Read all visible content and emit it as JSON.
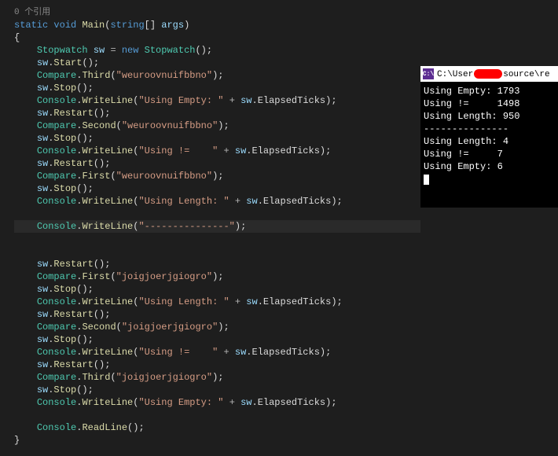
{
  "editor": {
    "ref_count": "0 个引用",
    "sig_static": "static",
    "sig_void": "void",
    "sig_main": "Main",
    "sig_string": "string",
    "sig_args": "args",
    "brace_open": "{",
    "brace_close": "}",
    "type_stopwatch": "Stopwatch",
    "var_sw": "sw",
    "kw_new": "new",
    "m_start": "Start",
    "m_stop": "Stop",
    "m_restart": "Restart",
    "m_writeline": "WriteLine",
    "m_readline": "ReadLine",
    "m_first": "First",
    "m_second": "Second",
    "m_third": "Third",
    "type_compare": "Compare",
    "type_console": "Console",
    "prop_elapsed": "ElapsedTicks",
    "str_test1": "\"weuroovnuifbbno\"",
    "str_test2": "\"joigjoerjgiogro\"",
    "str_empty": "\"Using Empty: \"",
    "str_ne": "\"Using !=    \"",
    "str_len": "\"Using Length: \"",
    "str_dash": "\"---------------\""
  },
  "console": {
    "title_prefix": "C:\\User",
    "title_suffix": "source\\re",
    "lines": {
      "l0": "Using Empty: 1793",
      "l1": "Using !=     1498",
      "l2": "Using Length: 950",
      "l3": "---------------",
      "l4": "Using Length: 4",
      "l5": "Using !=     7",
      "l6": "Using Empty: 6"
    }
  }
}
